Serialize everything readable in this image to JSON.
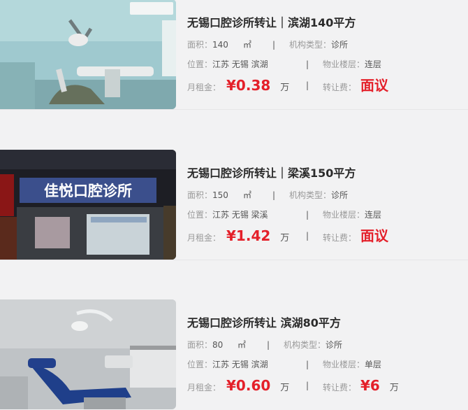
{
  "listings": [
    {
      "title": "无锡口腔诊所转让｜滨湖140平方",
      "area_label": "面积：",
      "area_value": "140",
      "area_unit": "㎡",
      "type_label": "机构类型：",
      "type_value": "诊所",
      "location_label": "位置：",
      "location_value": "江苏 无锡 滨湖",
      "floor_label": "物业楼层：",
      "floor_value": "连层",
      "rent_label": "月租金：",
      "rent_value": "¥0.38",
      "rent_unit": "万",
      "fee_label": "转让费：",
      "fee_value": "面议",
      "fee_unit": ""
    },
    {
      "title": "无锡口腔诊所转让｜梁溪150平方",
      "area_label": "面积：",
      "area_value": "150",
      "area_unit": "㎡",
      "type_label": "机构类型：",
      "type_value": "诊所",
      "location_label": "位置：",
      "location_value": "江苏 无锡 梁溪",
      "floor_label": "物业楼层：",
      "floor_value": "连层",
      "rent_label": "月租金：",
      "rent_value": "¥1.42",
      "rent_unit": "万",
      "fee_label": "转让费：",
      "fee_value": "面议",
      "fee_unit": "",
      "photo_sign": "佳悦口腔诊所"
    },
    {
      "title": "无锡口腔诊所转让 滨湖80平方",
      "area_label": "面积：",
      "area_value": "80",
      "area_unit": "㎡",
      "type_label": "机构类型：",
      "type_value": "诊所",
      "location_label": "位置：",
      "location_value": "江苏 无锡 滨湖",
      "floor_label": "物业楼层：",
      "floor_value": "单层",
      "rent_label": "月租金：",
      "rent_value": "¥0.60",
      "rent_unit": "万",
      "fee_label": "转让费：",
      "fee_value": "¥6",
      "fee_unit": "万"
    }
  ],
  "separator": "|",
  "colors": {
    "price": "#e4202a",
    "background": "#f2f2f3"
  }
}
